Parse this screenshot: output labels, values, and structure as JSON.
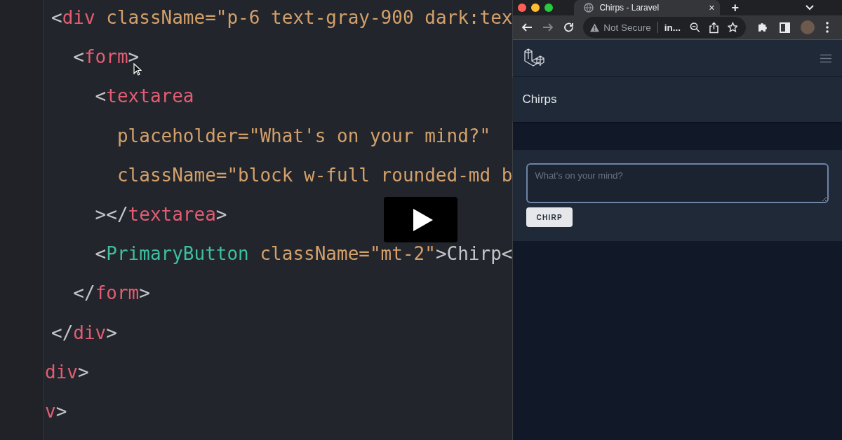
{
  "editor": {
    "lines": [
      {
        "tokens": [
          {
            "kind": "punct",
            "text": "<"
          },
          {
            "kind": "tag",
            "text": "div"
          },
          {
            "kind": "attr",
            "text": " className=\"p-6 text-gray-900 dark:tex"
          }
        ]
      },
      {
        "tokens": [
          {
            "kind": "punct",
            "text": "  <"
          },
          {
            "kind": "tag",
            "text": "form"
          },
          {
            "kind": "punct",
            "text": ">"
          }
        ]
      },
      {
        "tokens": [
          {
            "kind": "punct",
            "text": "    <"
          },
          {
            "kind": "tag",
            "text": "textarea"
          }
        ]
      },
      {
        "tokens": [
          {
            "kind": "attr",
            "text": "      placeholder=\"What's on your mind?\""
          }
        ]
      },
      {
        "tokens": [
          {
            "kind": "attr",
            "text": "      className=\"block w-full rounded-md b"
          }
        ]
      },
      {
        "tokens": [
          {
            "kind": "punct",
            "text": "    ></"
          },
          {
            "kind": "tag",
            "text": "textarea"
          },
          {
            "kind": "punct",
            "text": ">"
          }
        ]
      },
      {
        "tokens": [
          {
            "kind": "punct",
            "text": "    <"
          },
          {
            "kind": "component",
            "text": "PrimaryButton"
          },
          {
            "kind": "attr",
            "text": " className=\"mt-2\""
          },
          {
            "kind": "punct",
            "text": ">Chirp<"
          }
        ]
      },
      {
        "tokens": [
          {
            "kind": "punct",
            "text": "  </"
          },
          {
            "kind": "tag",
            "text": "form"
          },
          {
            "kind": "punct",
            "text": ">"
          }
        ]
      },
      {
        "tokens": [
          {
            "kind": "punct",
            "text": "</"
          },
          {
            "kind": "tag",
            "text": "div"
          },
          {
            "kind": "punct",
            "text": ">"
          }
        ]
      },
      {
        "tokens": [
          {
            "kind": "tag",
            "text": "div"
          },
          {
            "kind": "punct",
            "text": ">"
          }
        ]
      },
      {
        "tokens": [
          {
            "kind": "tag",
            "text": "v"
          },
          {
            "kind": "punct",
            "text": ">"
          }
        ]
      }
    ]
  },
  "browser": {
    "tab": {
      "title": "Chirps - Laravel",
      "close": "×",
      "selected": true
    },
    "new_tab": "+",
    "nav_buttons": [
      {
        "kind": "back",
        "disabled": false
      },
      {
        "kind": "forward",
        "disabled": true
      },
      {
        "kind": "reload",
        "disabled": false
      }
    ],
    "address": {
      "security": "Not Secure",
      "url": "in..."
    },
    "app": {
      "title": "Chirps",
      "placeholder": "What's on your mind?",
      "button": "CHIRP"
    }
  }
}
